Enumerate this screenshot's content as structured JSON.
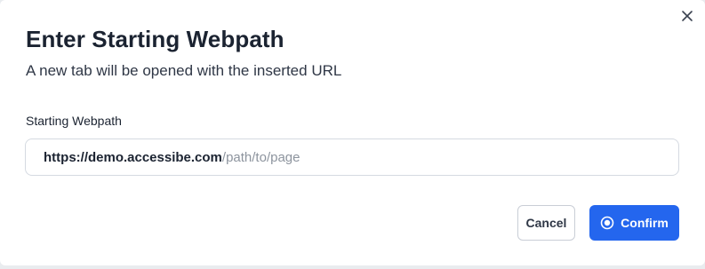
{
  "dialog": {
    "title": "Enter Starting Webpath",
    "subtitle": "A new tab will be opened with the inserted URL",
    "close_icon": "close-icon"
  },
  "field": {
    "label": "Starting Webpath",
    "url_base": "https://demo.accessibe.com",
    "url_path_placeholder": "/path/to/page"
  },
  "actions": {
    "cancel_label": "Cancel",
    "confirm_label": "Confirm",
    "confirm_icon": "radio-target-icon"
  },
  "colors": {
    "primary": "#2466ee",
    "title_text": "#1b2331",
    "placeholder_text": "#8d949e",
    "border": "#d5dae1"
  }
}
